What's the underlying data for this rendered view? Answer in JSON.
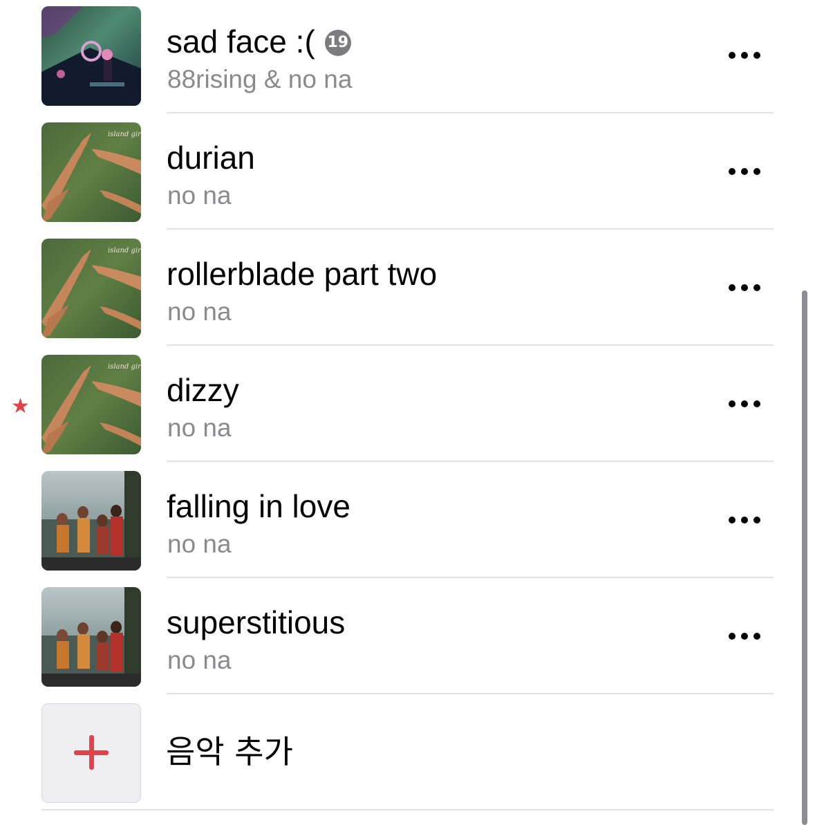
{
  "tracks": [
    {
      "title": "sad face :(",
      "artist": "88rising & no na",
      "explicit_badge": "19",
      "artwork": "sad-face-cover-art"
    },
    {
      "title": "durian",
      "artist": "no na",
      "artwork": "island-girl-cover-art"
    },
    {
      "title": "rollerblade part two",
      "artist": "no na",
      "artwork": "island-girl-cover-art"
    },
    {
      "title": "dizzy",
      "artist": "no na",
      "artwork": "island-girl-cover-art",
      "favorited": true
    },
    {
      "title": "falling in love",
      "artist": "no na",
      "artwork": "group-photo-cover-art"
    },
    {
      "title": "superstitious",
      "artist": "no na",
      "artwork": "group-photo-cover-art"
    }
  ],
  "add_music": {
    "label": "음악 추가",
    "icon": "plus-icon"
  },
  "icons": {
    "more": "ellipsis-icon",
    "favorite": "star-icon",
    "explicit": "explicit-badge"
  },
  "colors": {
    "accent": "#e2434b",
    "secondary_text": "#8a8a8e",
    "separator": "#e2e2e4",
    "badge": "#7c7c80"
  }
}
